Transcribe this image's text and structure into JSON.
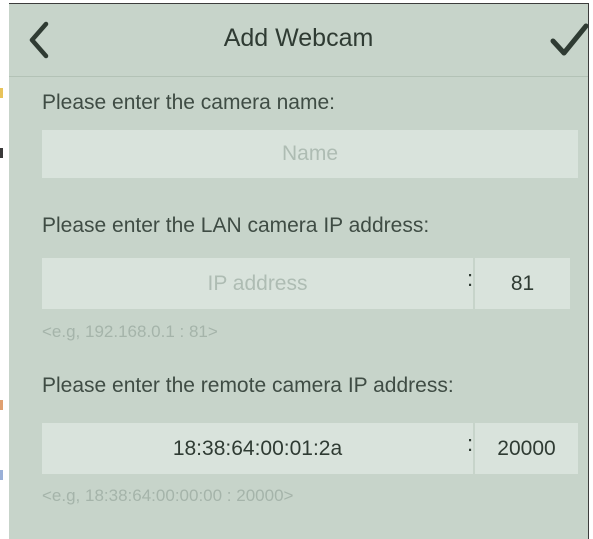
{
  "header": {
    "title": "Add Webcam"
  },
  "camera_name": {
    "label": "Please enter the camera name:",
    "placeholder": "Name",
    "value": ""
  },
  "lan": {
    "label": "Please enter the LAN camera IP address:",
    "ip_placeholder": "IP address",
    "ip_value": "",
    "separator": ":",
    "port_value": "81",
    "hint": "<e.g, 192.168.0.1 : 81>"
  },
  "remote": {
    "label": "Please enter the remote camera IP address:",
    "ip_value": "18:38:64:00:01:2a",
    "separator": ":",
    "port_value": "20000",
    "hint": "<e.g, 18:38:64:00:00:00 : 20000>"
  },
  "colors": {
    "background": "#c7d4ca",
    "field": "#d9e3dc",
    "text": "#2f3b33",
    "hint": "#a5b4aa"
  }
}
